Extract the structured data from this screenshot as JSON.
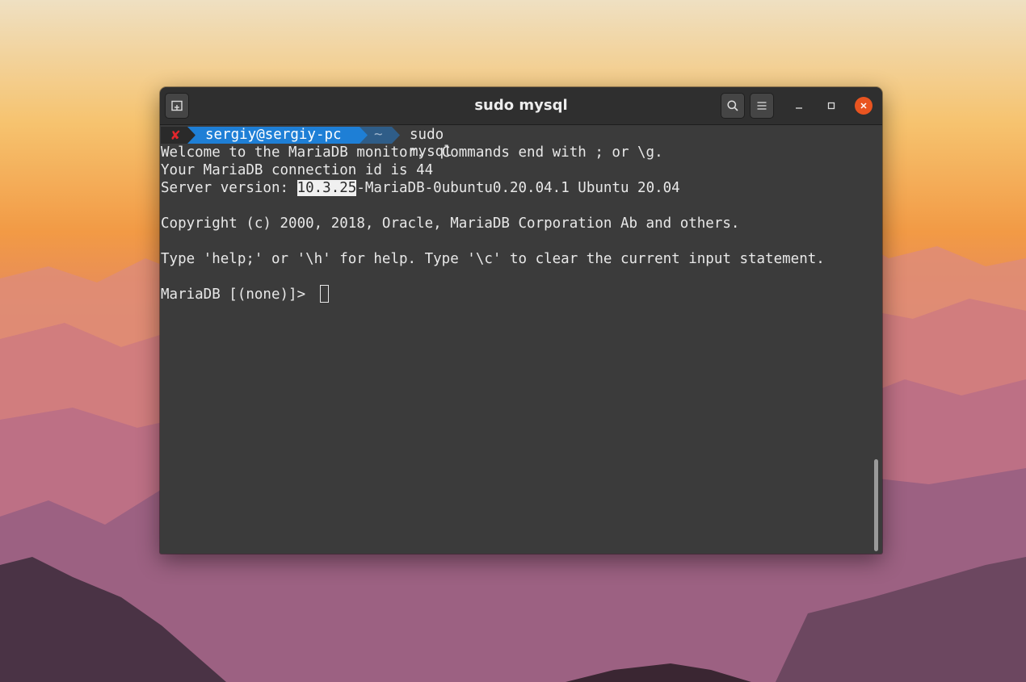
{
  "window": {
    "title": "sudo mysql"
  },
  "titlebar": {
    "new_tab_icon": "new-tab-icon",
    "search_icon": "search-icon",
    "menu_icon": "hamburger-menu-icon",
    "minimize_icon": "minimize-icon",
    "maximize_icon": "maximize-icon",
    "close_icon": "close-icon",
    "close_color": "#e95420"
  },
  "prompt": {
    "status_symbol": "✘",
    "user_host": "sergiy@sergiy-pc",
    "directory": "~",
    "command": "sudo mysql"
  },
  "output": {
    "line1": "Welcome to the MariaDB monitor.  Commands end with ; or \\g.",
    "line2": "Your MariaDB connection id is 44",
    "line3_prefix": "Server version: ",
    "line3_selected": "10.3.25",
    "line3_suffix": "-MariaDB-0ubuntu0.20.04.1 Ubuntu 20.04",
    "line4": "Copyright (c) 2000, 2018, Oracle, MariaDB Corporation Ab and others.",
    "line5": "Type 'help;' or '\\h' for help. Type '\\c' to clear the current input statement.",
    "mariadb_prompt": "MariaDB [(none)]> "
  },
  "colors": {
    "terminal_bg": "#3b3b3b",
    "titlebar_bg": "#2f2f2f",
    "prompt_user_bg": "#1e7fd6",
    "prompt_dir_bg": "#2f5d88",
    "error_x": "#e3262c"
  }
}
